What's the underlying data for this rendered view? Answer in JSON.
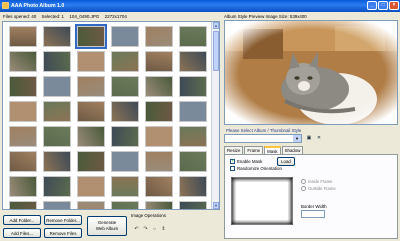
{
  "window": {
    "title": "AAA Photo Album 1.0"
  },
  "status": {
    "files_opened": "Files opened: 40",
    "selected": "Selected: 1",
    "file_info": "104_0490.JPG",
    "dimensions": "2272x1704"
  },
  "buttons": {
    "add_folder": "Add Folder...",
    "remove_folder": "Remove Folder...",
    "add_files": "Add Files...",
    "remove_files": "Remove Files",
    "generate_line1": "Generate",
    "generate_line2": "Web Album"
  },
  "image_operations": {
    "label": "Image Operations"
  },
  "preview": {
    "label": "Album Style Preview  Image Size: 539x400"
  },
  "album_style": {
    "label": "Please Select Album / Thumbnail Style"
  },
  "tabs": [
    {
      "label": "Resize"
    },
    {
      "label": "Frame"
    },
    {
      "label": "Mask"
    },
    {
      "label": "Shadow"
    }
  ],
  "mask_panel": {
    "enable_mask": "Enable Mask",
    "randomize": "Randomize Orientation",
    "load": "Load",
    "inside_frame": "Inside Frame",
    "outside_frame": "Outside Frame",
    "border_width": "Border Width"
  },
  "colors": {
    "titlebar": "#0a5ad8",
    "selection": "#316ac5",
    "tab_highlight": "#ffc83c"
  }
}
